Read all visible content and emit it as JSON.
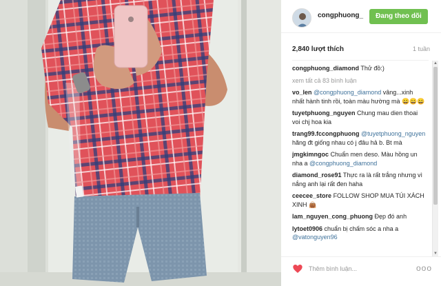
{
  "post": {
    "username": "congphuong_",
    "follow_label": "Đang theo dõi",
    "likes": "2,840 lượt thích",
    "time": "1 tuần",
    "colors": {
      "follow_button": "#70c050",
      "mention": "#3f729b",
      "heart": "#ed4956"
    }
  },
  "caption": {
    "user": "congphuong_diamond",
    "text": "Thử đồ:)"
  },
  "view_all": "xem tất cả 83 bình luận",
  "comments": [
    {
      "user": "vo_len",
      "mention": "@congphuong_diamond",
      "text": "vâng...xinh nhất hành tinh rồi, toàn màu hường mà 😀😀😀",
      "mention_first": true
    },
    {
      "user": "tuyetphuong_nguyen",
      "mention": "",
      "text": "Chung mau dien thoai voi chj hoa kia",
      "mention_first": true
    },
    {
      "user": "trang99.fccongphuong",
      "mention": "@tuyetphuong_nguyen",
      "text": "hãng đt giống nhau có j đâu hả b. Bt mà",
      "mention_first": true
    },
    {
      "user": "jmgkimngoc",
      "mention": "@congphuong_diamond",
      "text": "Chuẩn men deso. Màu hồng un nha a",
      "mention_first": false
    },
    {
      "user": "diamond_rose91",
      "mention": "",
      "text": "Thực ra là rất trắng nhưng vì nắng anh lại rất đen haha",
      "mention_first": true
    },
    {
      "user": "ceecee_store",
      "mention": "",
      "text": "FOLLOW SHOP MUA TÚI XÁCH XINH 👜",
      "mention_first": true
    },
    {
      "user": "lam_nguyen_cong_phuong",
      "mention": "",
      "text": "Đẹp đó anh",
      "mention_first": true
    },
    {
      "user": "lytoet0906",
      "mention": "@vatonguyen96",
      "text": "chuẩn bị chấm sóc a nha a",
      "mention_first": false
    }
  ],
  "footer": {
    "placeholder": "Thêm bình luận...",
    "more": "ooo",
    "icons": [
      "heart-icon",
      "more-options-icon"
    ]
  }
}
